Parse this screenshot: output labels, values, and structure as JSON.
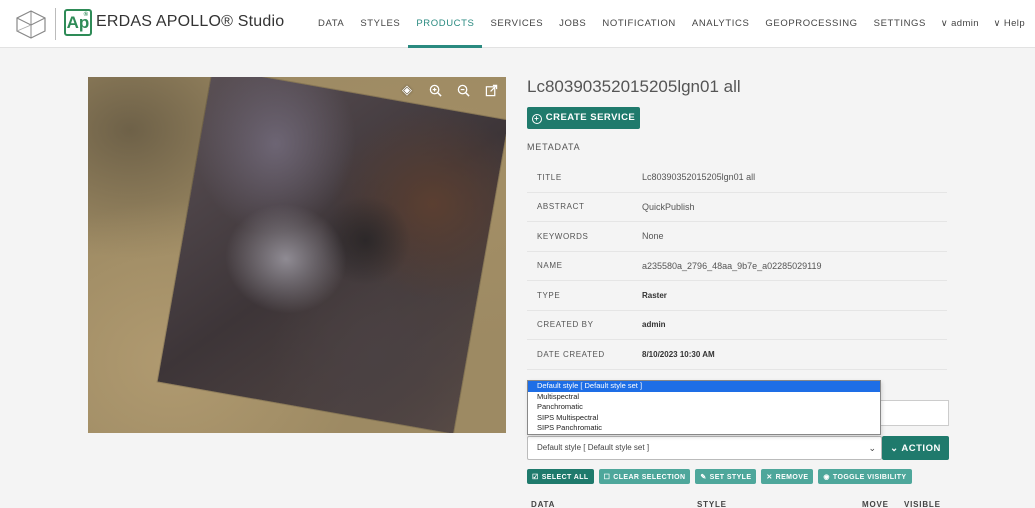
{
  "header": {
    "brand_badge": "Ap",
    "brand_badge_mark": "®",
    "app_title": "ERDAS APOLLO® Studio",
    "nav": [
      "DATA",
      "STYLES",
      "PRODUCTS",
      "SERVICES",
      "JOBS",
      "NOTIFICATION",
      "ANALYTICS",
      "GEOPROCESSING",
      "SETTINGS"
    ],
    "active_nav": "PRODUCTS",
    "user_label": "∨ admin",
    "help_label": "∨ Help"
  },
  "map": {
    "tools": [
      "locate-icon",
      "zoom-in-icon",
      "zoom-out-icon",
      "open-external-icon"
    ]
  },
  "product": {
    "title": "Lc80390352015205lgn01 all",
    "create_service_label": "CREATE SERVICE",
    "metadata_heading": "METADATA",
    "metadata": [
      {
        "key": "TITLE",
        "value": "Lc80390352015205lgn01 all",
        "bold": false
      },
      {
        "key": "ABSTRACT",
        "value": "QuickPublish",
        "bold": false
      },
      {
        "key": "KEYWORDS",
        "value": "None",
        "bold": false
      },
      {
        "key": "NAME",
        "value": "a235580a_2796_48aa_9b7e_a02285029119",
        "bold": false
      },
      {
        "key": "TYPE",
        "value": "Raster",
        "bold": true
      },
      {
        "key": "CREATED BY",
        "value": "admin",
        "bold": true
      },
      {
        "key": "DATE CREATED",
        "value": "8/10/2023 10:30 AM",
        "bold": true
      }
    ]
  },
  "style_select": {
    "selected": "Default style [ Default style set ]",
    "options": [
      "Default style [ Default style set ]",
      "Multispectral",
      "Panchromatic",
      "SIPS Multispectral",
      "SIPS Panchromatic"
    ],
    "caret": "⌄"
  },
  "action_label": "ACTION",
  "bulk_actions": [
    {
      "label": "SELECT ALL",
      "icon": "☑",
      "style": "dark"
    },
    {
      "label": "CLEAR SELECTION",
      "icon": "☐",
      "style": "light"
    },
    {
      "label": "SET STYLE",
      "icon": "✎",
      "style": "light"
    },
    {
      "label": "REMOVE",
      "icon": "✕",
      "style": "light"
    },
    {
      "label": "TOGGLE VISIBILITY",
      "icon": "◉",
      "style": "light"
    }
  ],
  "columns": {
    "data": "DATA",
    "style": "STYLE",
    "move": "MOVE",
    "visible": "VISIBLE"
  },
  "colors": {
    "accent": "#1f7a6c",
    "accent_light": "#4ea79b",
    "brand_green": "#2e8b57",
    "select_highlight": "#1e6ee6"
  }
}
